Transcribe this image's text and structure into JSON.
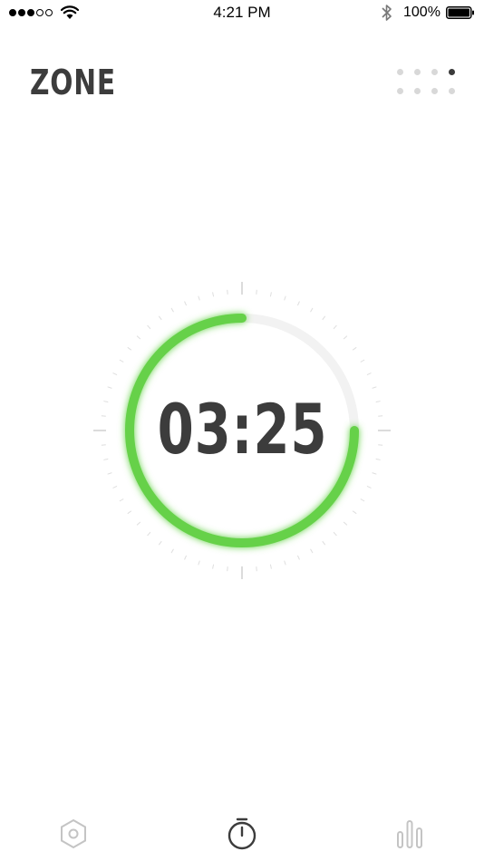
{
  "status_bar": {
    "time": "4:21 PM",
    "battery_percent": "100%",
    "signal_bars_filled": 3,
    "signal_bars_total": 5
  },
  "header": {
    "title": "ZONE",
    "page_indicator_total": 8,
    "page_indicator_active": 4
  },
  "timer": {
    "time": "03:25",
    "progress_fraction": 0.75
  },
  "colors": {
    "accent": "#66d14a",
    "track": "#f2f2f2",
    "text": "#3c3c3c",
    "tab_inactive": "#c4c4c4",
    "tab_active": "#3c3c3c"
  },
  "tab_bar": {
    "tabs": [
      {
        "icon": "hexagon-settings-icon",
        "active": false
      },
      {
        "icon": "stopwatch-icon",
        "active": true
      },
      {
        "icon": "bar-chart-icon",
        "active": false
      }
    ]
  }
}
